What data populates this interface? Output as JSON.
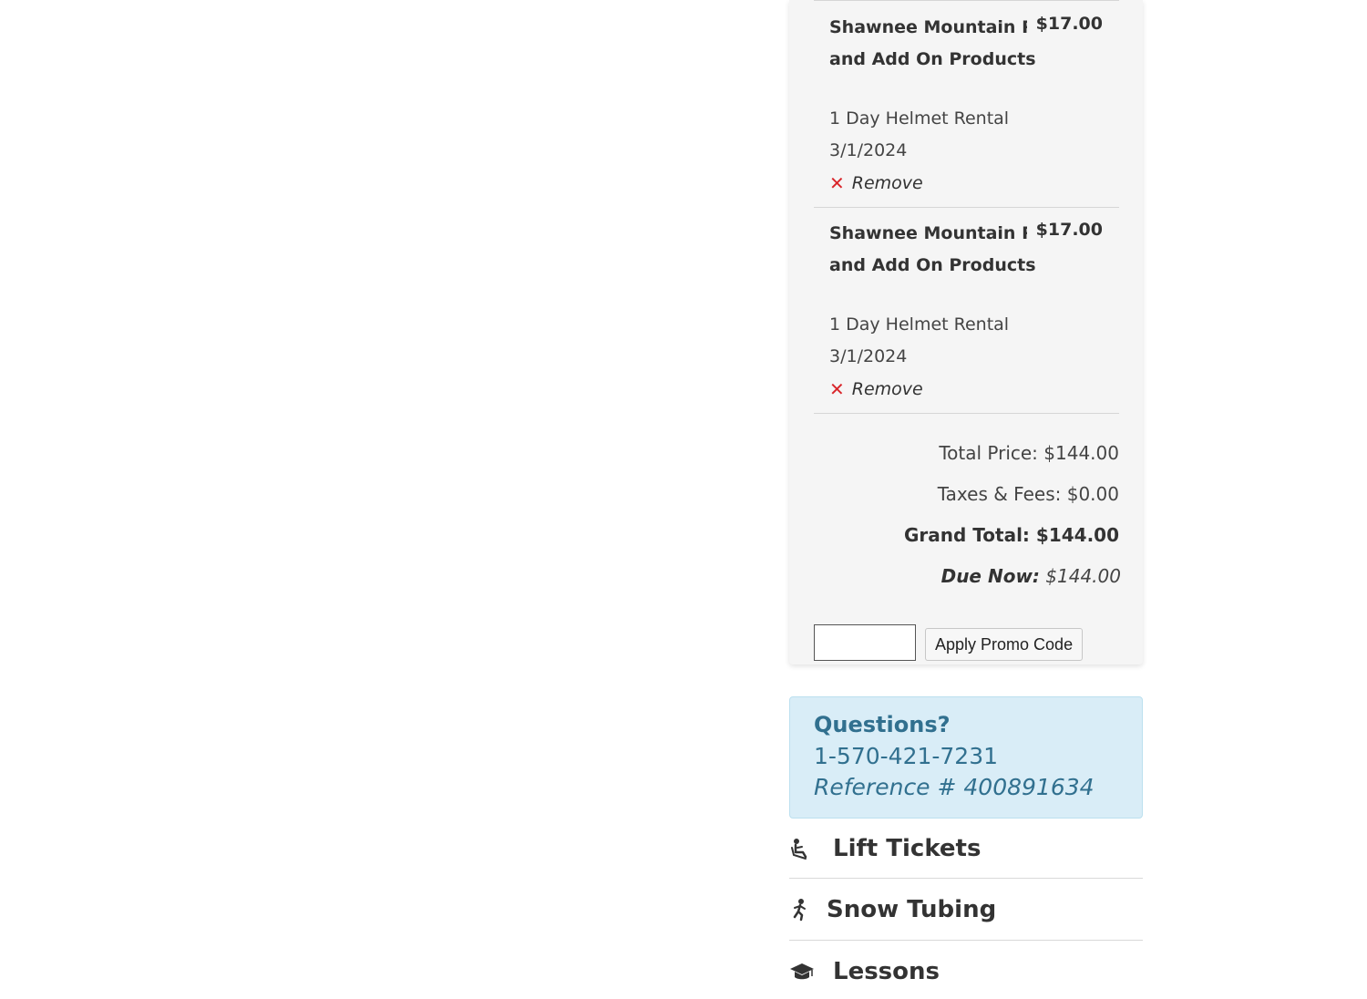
{
  "cart": {
    "items": [
      {
        "name": "Shawnee Mountain Rentals and Add On Products",
        "price": "$17.00",
        "description": "1 Day Helmet Rental",
        "date": "3/1/2024",
        "remove_label": "Remove"
      },
      {
        "name": "Shawnee Mountain Rentals and Add On Products",
        "price": "$17.00",
        "description": "1 Day Helmet Rental",
        "date": "3/1/2024",
        "remove_label": "Remove"
      }
    ],
    "totals": {
      "total_price_label": "Total Price:",
      "total_price": "$144.00",
      "taxes_label": "Taxes & Fees:",
      "taxes": "$0.00",
      "grand_total_label": "Grand Total:",
      "grand_total": "$144.00",
      "due_now_label": "Due Now:",
      "due_now": "$144.00"
    },
    "promo": {
      "input_value": "",
      "button_label": "Apply Promo Code"
    }
  },
  "questions": {
    "title": "Questions?",
    "phone": "1-570-421-7231",
    "reference": "Reference # 400891634"
  },
  "nav": [
    {
      "label": "Lift Tickets",
      "icon": "ski-lift-icon"
    },
    {
      "label": "Snow Tubing",
      "icon": "snow-tubing-icon"
    },
    {
      "label": "Lessons",
      "icon": "graduation-cap-icon"
    }
  ],
  "colors": {
    "panel_bg": "#f5f5f5",
    "remove_x": "#d9262b",
    "info_bg": "#d9edf7",
    "info_text": "#31708f"
  }
}
